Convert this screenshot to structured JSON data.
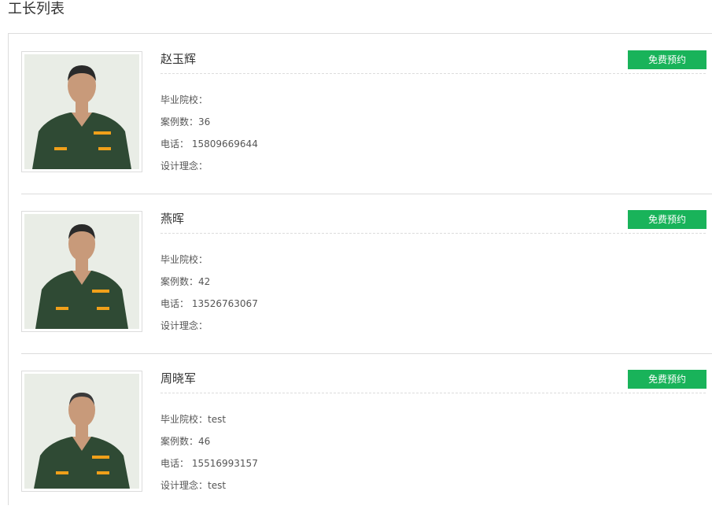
{
  "page": {
    "title": "工长列表"
  },
  "foremen": [
    {
      "name": "赵玉辉",
      "book_label": "免费预约",
      "school_label": "毕业院校：",
      "school_value": "",
      "cases_label": "案例数：",
      "cases_value": "36",
      "phone_label": "电话：",
      "phone_value": "15809669644",
      "philosophy_label": "设计理念：",
      "philosophy_value": ""
    },
    {
      "name": "燕晖",
      "book_label": "免费预约",
      "school_label": "毕业院校：",
      "school_value": "",
      "cases_label": "案例数：",
      "cases_value": "42",
      "phone_label": "电话：",
      "phone_value": "13526763067",
      "philosophy_label": "设计理念：",
      "philosophy_value": ""
    },
    {
      "name": "周晓军",
      "book_label": "免费预约",
      "school_label": "毕业院校：",
      "school_value": "test",
      "cases_label": "案例数：",
      "cases_value": "46",
      "phone_label": "电话：",
      "phone_value": "15516993157",
      "philosophy_label": "设计理念：",
      "philosophy_value": "test"
    }
  ],
  "colors": {
    "accent": "#19b35a",
    "uniform": "#2f4a34",
    "uniform_trim": "#f0a01a",
    "photo_bg": "#e9ede6",
    "skin": "#c89a7a",
    "hair": "#2a2a2a"
  }
}
